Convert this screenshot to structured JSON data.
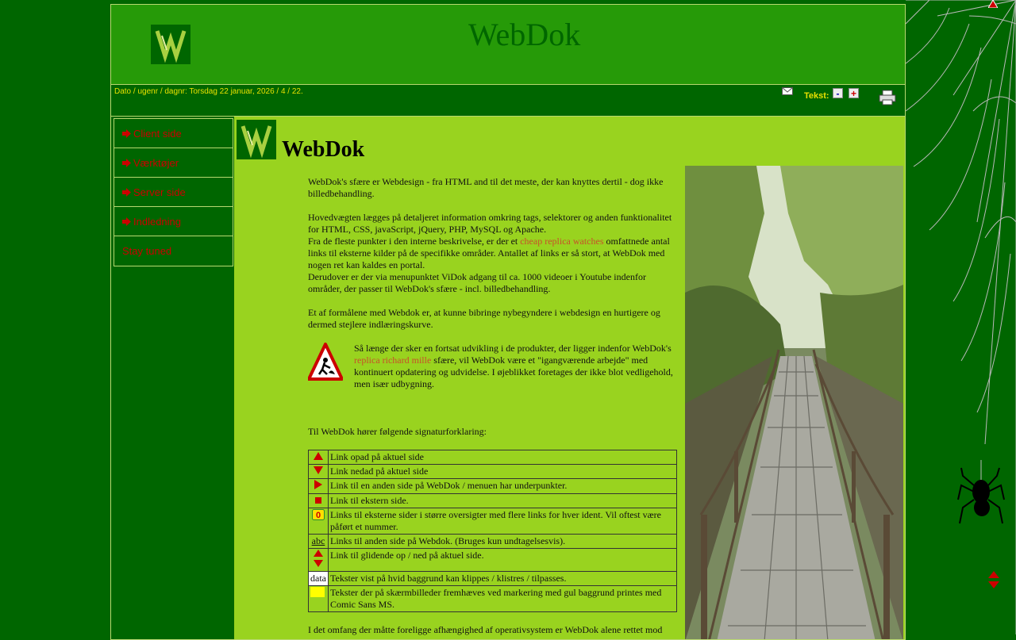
{
  "header": {
    "title": "WebDok",
    "date_text": "Dato / ugenr / dagnr: Torsdag 22 januar, 2026 / 4 / 22.",
    "text_label": "Tekst:",
    "minus_label": "-",
    "plus_label": "+"
  },
  "sidebar": {
    "items": [
      {
        "label": "Client side"
      },
      {
        "label": "Værktøjer"
      },
      {
        "label": "Server side"
      },
      {
        "label": "Indledning"
      },
      {
        "label": "Stay tuned"
      }
    ]
  },
  "main": {
    "heading": "WebDok",
    "p1": "WebDok's sfære er Webdesign - fra HTML and til det meste, der kan knyttes dertil - dog ikke billedbehandling.",
    "p2_a": "Hovedvægten lægges på detaljeret information omkring tags, selektorer og anden funktionalitet for HTML, CSS, javaScript, jQuery, PHP, MySQL og Apache.",
    "p2_b": "Fra de fleste punkter i den interne beskrivelse, er der et",
    "p2_link": "cheap replica watches",
    "p2_c": "omfattnede antal links til eksterne kilder på de specifikke områder. Antallet af links er så stort, at WebDok med nogen ret kan kaldes en portal.",
    "p2_d": "Derudover er der via menupunktet ViDok adgang til ca. 1000 videoer i Youtube indenfor områder, der passer til WebDok's sfære - incl. billedbehandling.",
    "p3": "Et af formålene med Webdok er, at kunne bibringe nybegyndere i webdesign en hurtigere og dermed stejlere indlæringskurve.",
    "p4_a": "Så længe der sker en fortsat udvikling i de produkter, der ligger indenfor WebDok's",
    "p4_link": "replica richard mille",
    "p4_b": "sfære, vil WebDok være et \"igangværende arbejde\" med kontinuert opdatering og udvidelse. I øjeblikket foretages der ikke blot vedligehold, men især udbygning.",
    "legend_title": "Til WebDok hører følgende signaturforklaring:",
    "legend": [
      {
        "icon": "up-arrow-icon",
        "text": "Link opad på aktuel side"
      },
      {
        "icon": "down-arrow-icon",
        "text": "Link nedad på aktuel side"
      },
      {
        "icon": "right-arrow-icon",
        "text": "Link til en anden side på WebDok / menuen har underpunkter."
      },
      {
        "icon": "square-icon",
        "text": "Link til ekstern side."
      },
      {
        "icon": "zero-badge-icon",
        "text": "Links til eksterne sider i større oversigter med flere links for hver ident. Vil oftest være påført et nummer."
      },
      {
        "icon": "abc-link",
        "icon_text": "abc",
        "text": "Links til anden side på Webdok. (Bruges kun undtagelsesvis)."
      },
      {
        "icon": "updown-arrow-icon",
        "text": "Link til glidende op / ned på aktuel side."
      },
      {
        "icon": "data-box",
        "icon_text": "data",
        "text": "Tekster vist på hvid baggrund kan klippes / klistres / tilpasses."
      },
      {
        "icon": "yellow-box",
        "text": "Tekster der på skærmbilleder fremhæves ved markering med gul baggrund printes med Comic Sans MS."
      }
    ],
    "trailing": "I det omfang der måtte foreligge afhængighed af operativsystem er WebDok alene rettet mod"
  },
  "colors": {
    "page_bg": "#006600",
    "header_bg": "#269a08",
    "content_bg": "#99d31f",
    "link_red": "#cc0000",
    "date_yellow": "#e8e000"
  }
}
